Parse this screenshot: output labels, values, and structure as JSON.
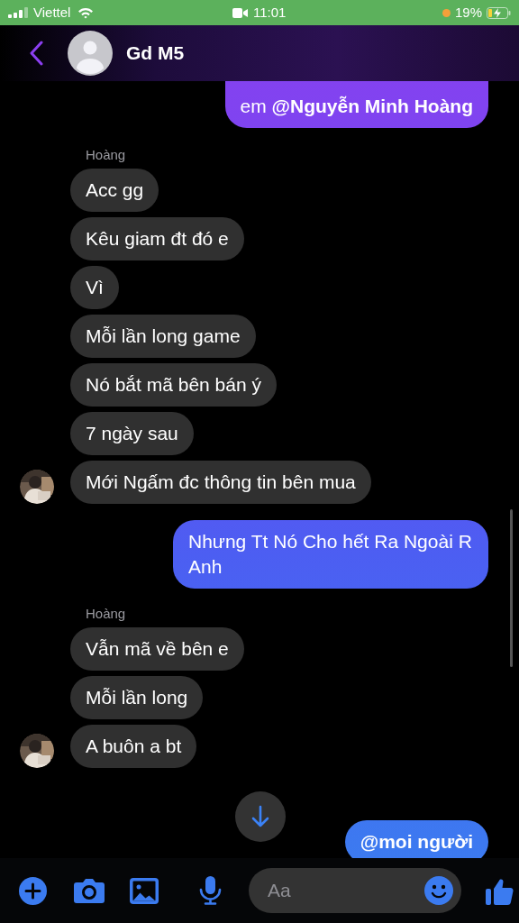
{
  "status_bar": {
    "carrier": "Viettel",
    "time": "11:01",
    "battery": "19%"
  },
  "header": {
    "title": "Gd M5"
  },
  "groups": [
    {
      "kind": "sent",
      "messages": [
        "em **@Nguyễn Minh Hoàng**"
      ]
    },
    {
      "kind": "received",
      "sender": "Hoàng",
      "messages": [
        "Acc gg",
        "Kêu giam đt đó e",
        "Vì",
        "Mỗi lần long game",
        "Nó bắt mã bên bán ý",
        "7 ngày sau",
        "Mới Ngấm đc thông tin bên mua"
      ]
    },
    {
      "kind": "sent",
      "messages": [
        "Nhưng Tt Nó Cho hết Ra Ngoài R Anh"
      ]
    },
    {
      "kind": "received",
      "sender": "Hoàng",
      "messages": [
        "Vẫn mã về bên e",
        "Mỗi lần long",
        "A buôn a bt"
      ]
    },
    {
      "kind": "sent",
      "bold": true,
      "messages": [
        "@moi người"
      ]
    }
  ],
  "composer": {
    "placeholder": "Aa"
  }
}
